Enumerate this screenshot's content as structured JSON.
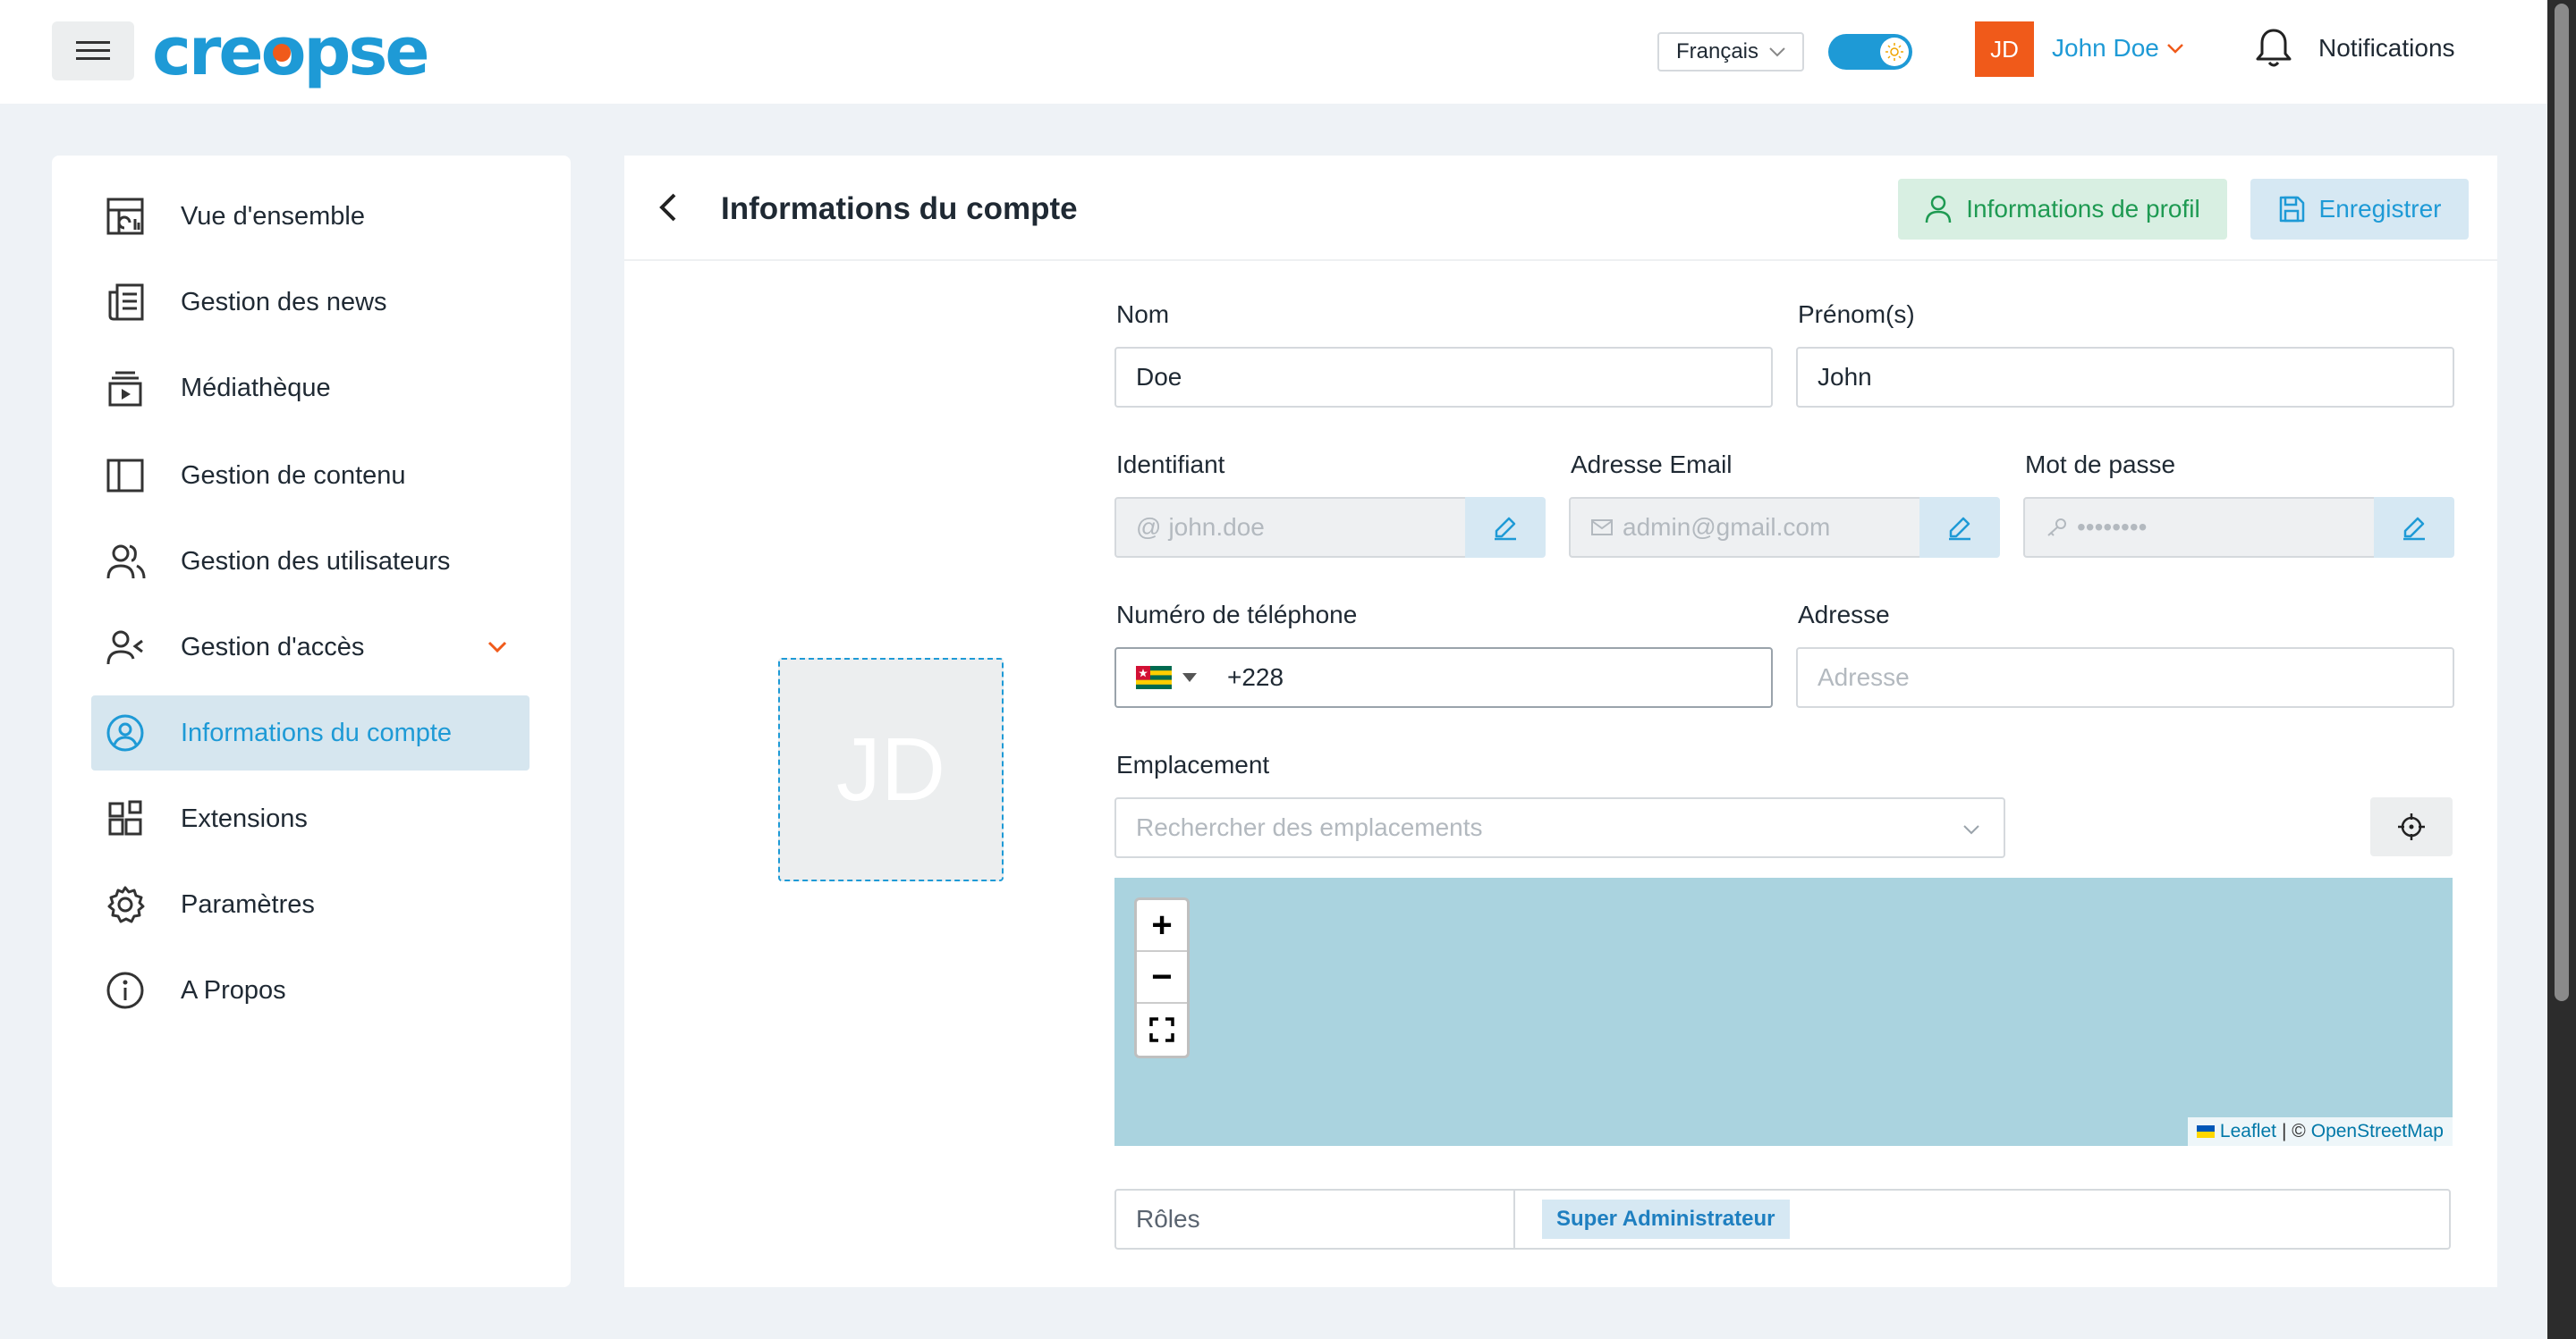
{
  "topbar": {
    "logo_text": "creopse",
    "language": "Français",
    "user_initials": "JD",
    "user_name": "John Doe",
    "notifications_label": "Notifications",
    "brand_color": "#1e9ad6",
    "accent_color": "#f05a1a"
  },
  "sidebar": {
    "items": [
      {
        "label": "Vue d'ensemble",
        "icon": "dashboard-icon"
      },
      {
        "label": "Gestion des news",
        "icon": "newspaper-icon"
      },
      {
        "label": "Médiathèque",
        "icon": "media-library-icon"
      },
      {
        "label": "Gestion de contenu",
        "icon": "layout-icon"
      },
      {
        "label": "Gestion des utilisateurs",
        "icon": "users-icon"
      },
      {
        "label": "Gestion d'accès",
        "icon": "user-access-icon"
      },
      {
        "label": "Informations du compte",
        "icon": "user-circle-icon",
        "active": true
      },
      {
        "label": "Extensions",
        "icon": "extensions-icon"
      },
      {
        "label": "Paramètres",
        "icon": "gear-icon"
      },
      {
        "label": "A Propos",
        "icon": "info-icon"
      }
    ]
  },
  "main": {
    "title": "Informations du compte",
    "profile_button": "Informations de profil",
    "save_button": "Enregistrer",
    "avatar_initials": "JD",
    "fields": {
      "nom": {
        "label": "Nom",
        "value": "Doe"
      },
      "prenom": {
        "label": "Prénom(s)",
        "value": "John"
      },
      "identifiant": {
        "label": "Identifiant",
        "value": "john.doe"
      },
      "email": {
        "label": "Adresse Email",
        "value": "admin@gmail.com"
      },
      "password": {
        "label": "Mot de passe",
        "value": "••••••••"
      },
      "phone": {
        "label": "Numéro de téléphone",
        "value": "+228"
      },
      "adresse": {
        "label": "Adresse",
        "placeholder": "Adresse"
      },
      "emplacement": {
        "label": "Emplacement",
        "placeholder": "Rechercher des emplacements"
      }
    },
    "map": {
      "zoom_in": "+",
      "zoom_out": "−",
      "attribution_leaflet": "Leaflet",
      "attribution_sep": "| ©",
      "attribution_osm": "OpenStreetMap"
    },
    "roles": {
      "label": "Rôles",
      "tag": "Super Administrateur"
    }
  }
}
